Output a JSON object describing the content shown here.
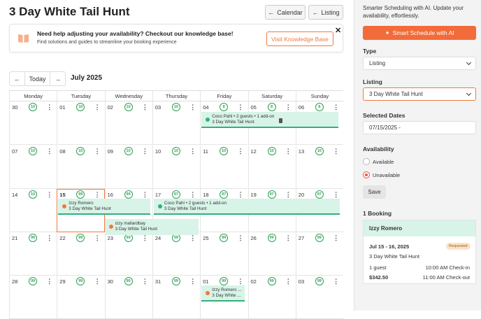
{
  "header": {
    "title": "3 Day White Tail Hunt",
    "calendar_btn": "Calendar",
    "listing_btn": "Listing"
  },
  "kb": {
    "heading": "Need help adjusting your availability? Checkout our knowledge base!",
    "sub": "Find solutions and guides to streamline your booking experience",
    "button": "Visit Knowledge Base",
    "close": "✕"
  },
  "nav": {
    "today": "Today",
    "month": "July 2025",
    "prev": "←",
    "next": "→"
  },
  "calendar": {
    "day_names": [
      "Monday",
      "Tuesday",
      "Wednesday",
      "Thursday",
      "Friday",
      "Saturday",
      "Sunday"
    ],
    "weeks": [
      [
        [
          "30",
          "10"
        ],
        [
          "01",
          "10"
        ],
        [
          "02",
          "10"
        ],
        [
          "03",
          "10"
        ],
        [
          "04",
          "8"
        ],
        [
          "05",
          "8"
        ],
        [
          "06",
          "8"
        ]
      ],
      [
        [
          "07",
          "10"
        ],
        [
          "08",
          "10"
        ],
        [
          "09",
          "10"
        ],
        [
          "10",
          "10"
        ],
        [
          "11",
          "10"
        ],
        [
          "12",
          "10"
        ],
        [
          "13",
          "10"
        ]
      ],
      [
        [
          "14",
          "10"
        ],
        [
          "15",
          "99"
        ],
        [
          "16",
          "99"
        ],
        [
          "17",
          "97"
        ],
        [
          "18",
          "97"
        ],
        [
          "19",
          "97"
        ],
        [
          "20",
          "97"
        ]
      ],
      [
        [
          "21",
          "99"
        ],
        [
          "22",
          "99"
        ],
        [
          "23",
          "99"
        ],
        [
          "24",
          "99"
        ],
        [
          "25",
          "99"
        ],
        [
          "26",
          "99"
        ],
        [
          "27",
          "99"
        ]
      ],
      [
        [
          "28",
          "99"
        ],
        [
          "29",
          "99"
        ],
        [
          "30",
          "99"
        ],
        [
          "31",
          "99"
        ],
        [
          "01",
          "99"
        ],
        [
          "02",
          "99"
        ],
        [
          "03",
          "99"
        ]
      ]
    ],
    "today_label": "15",
    "events": [
      {
        "l1": "Coco Pahl • 2 guests • 1 add-on",
        "l2": "3 Day White Tail Hunt",
        "color": "#2fb27a"
      },
      {
        "l1": "Izzy Romero",
        "l2": "3 Day White Tail Hunt",
        "color": "#f07a3e"
      },
      {
        "l1": "Coco Pahl • 2 guests • 1 add-on",
        "l2": "3 Day White Tail Hunt",
        "color": "#2fb27a"
      },
      {
        "l1": "izzy mallardbay",
        "l2": "3 Day White Tail Hunt",
        "color": "#f07a3e"
      },
      {
        "l1": "Izzy Romero ...",
        "l2": "3 Day White ...",
        "color": "#f07a3e"
      }
    ]
  },
  "sidebar": {
    "intro": "Smarter Scheduling with AI. Update your availability, effortlessly.",
    "smart_btn": "Smart Schedule with AI",
    "type_label": "Type",
    "type_value": "Listing",
    "listing_label": "Listing",
    "listing_value": "3 Day White Tail Hunt",
    "dates_label": "Selected Dates",
    "dates_value": "07/15/2025 -",
    "avail_label": "Availability",
    "opt_available": "Available",
    "opt_unavailable": "Unavailable",
    "save": "Save",
    "booking_count": "1 Booking",
    "booking": {
      "name": "Izzy Romero",
      "dates": "Jul 15 - 16, 2025",
      "status": "Requested",
      "listing": "3 Day White Tail Hunt",
      "guests": "1 guest",
      "checkin": "10:00 AM Check-in",
      "price": "$342.50",
      "checkout": "11:00 AM Check-out"
    }
  },
  "colors": {
    "accent": "#f26b3a",
    "green": "#2e9f55",
    "event_bg": "#d8f3e8"
  }
}
